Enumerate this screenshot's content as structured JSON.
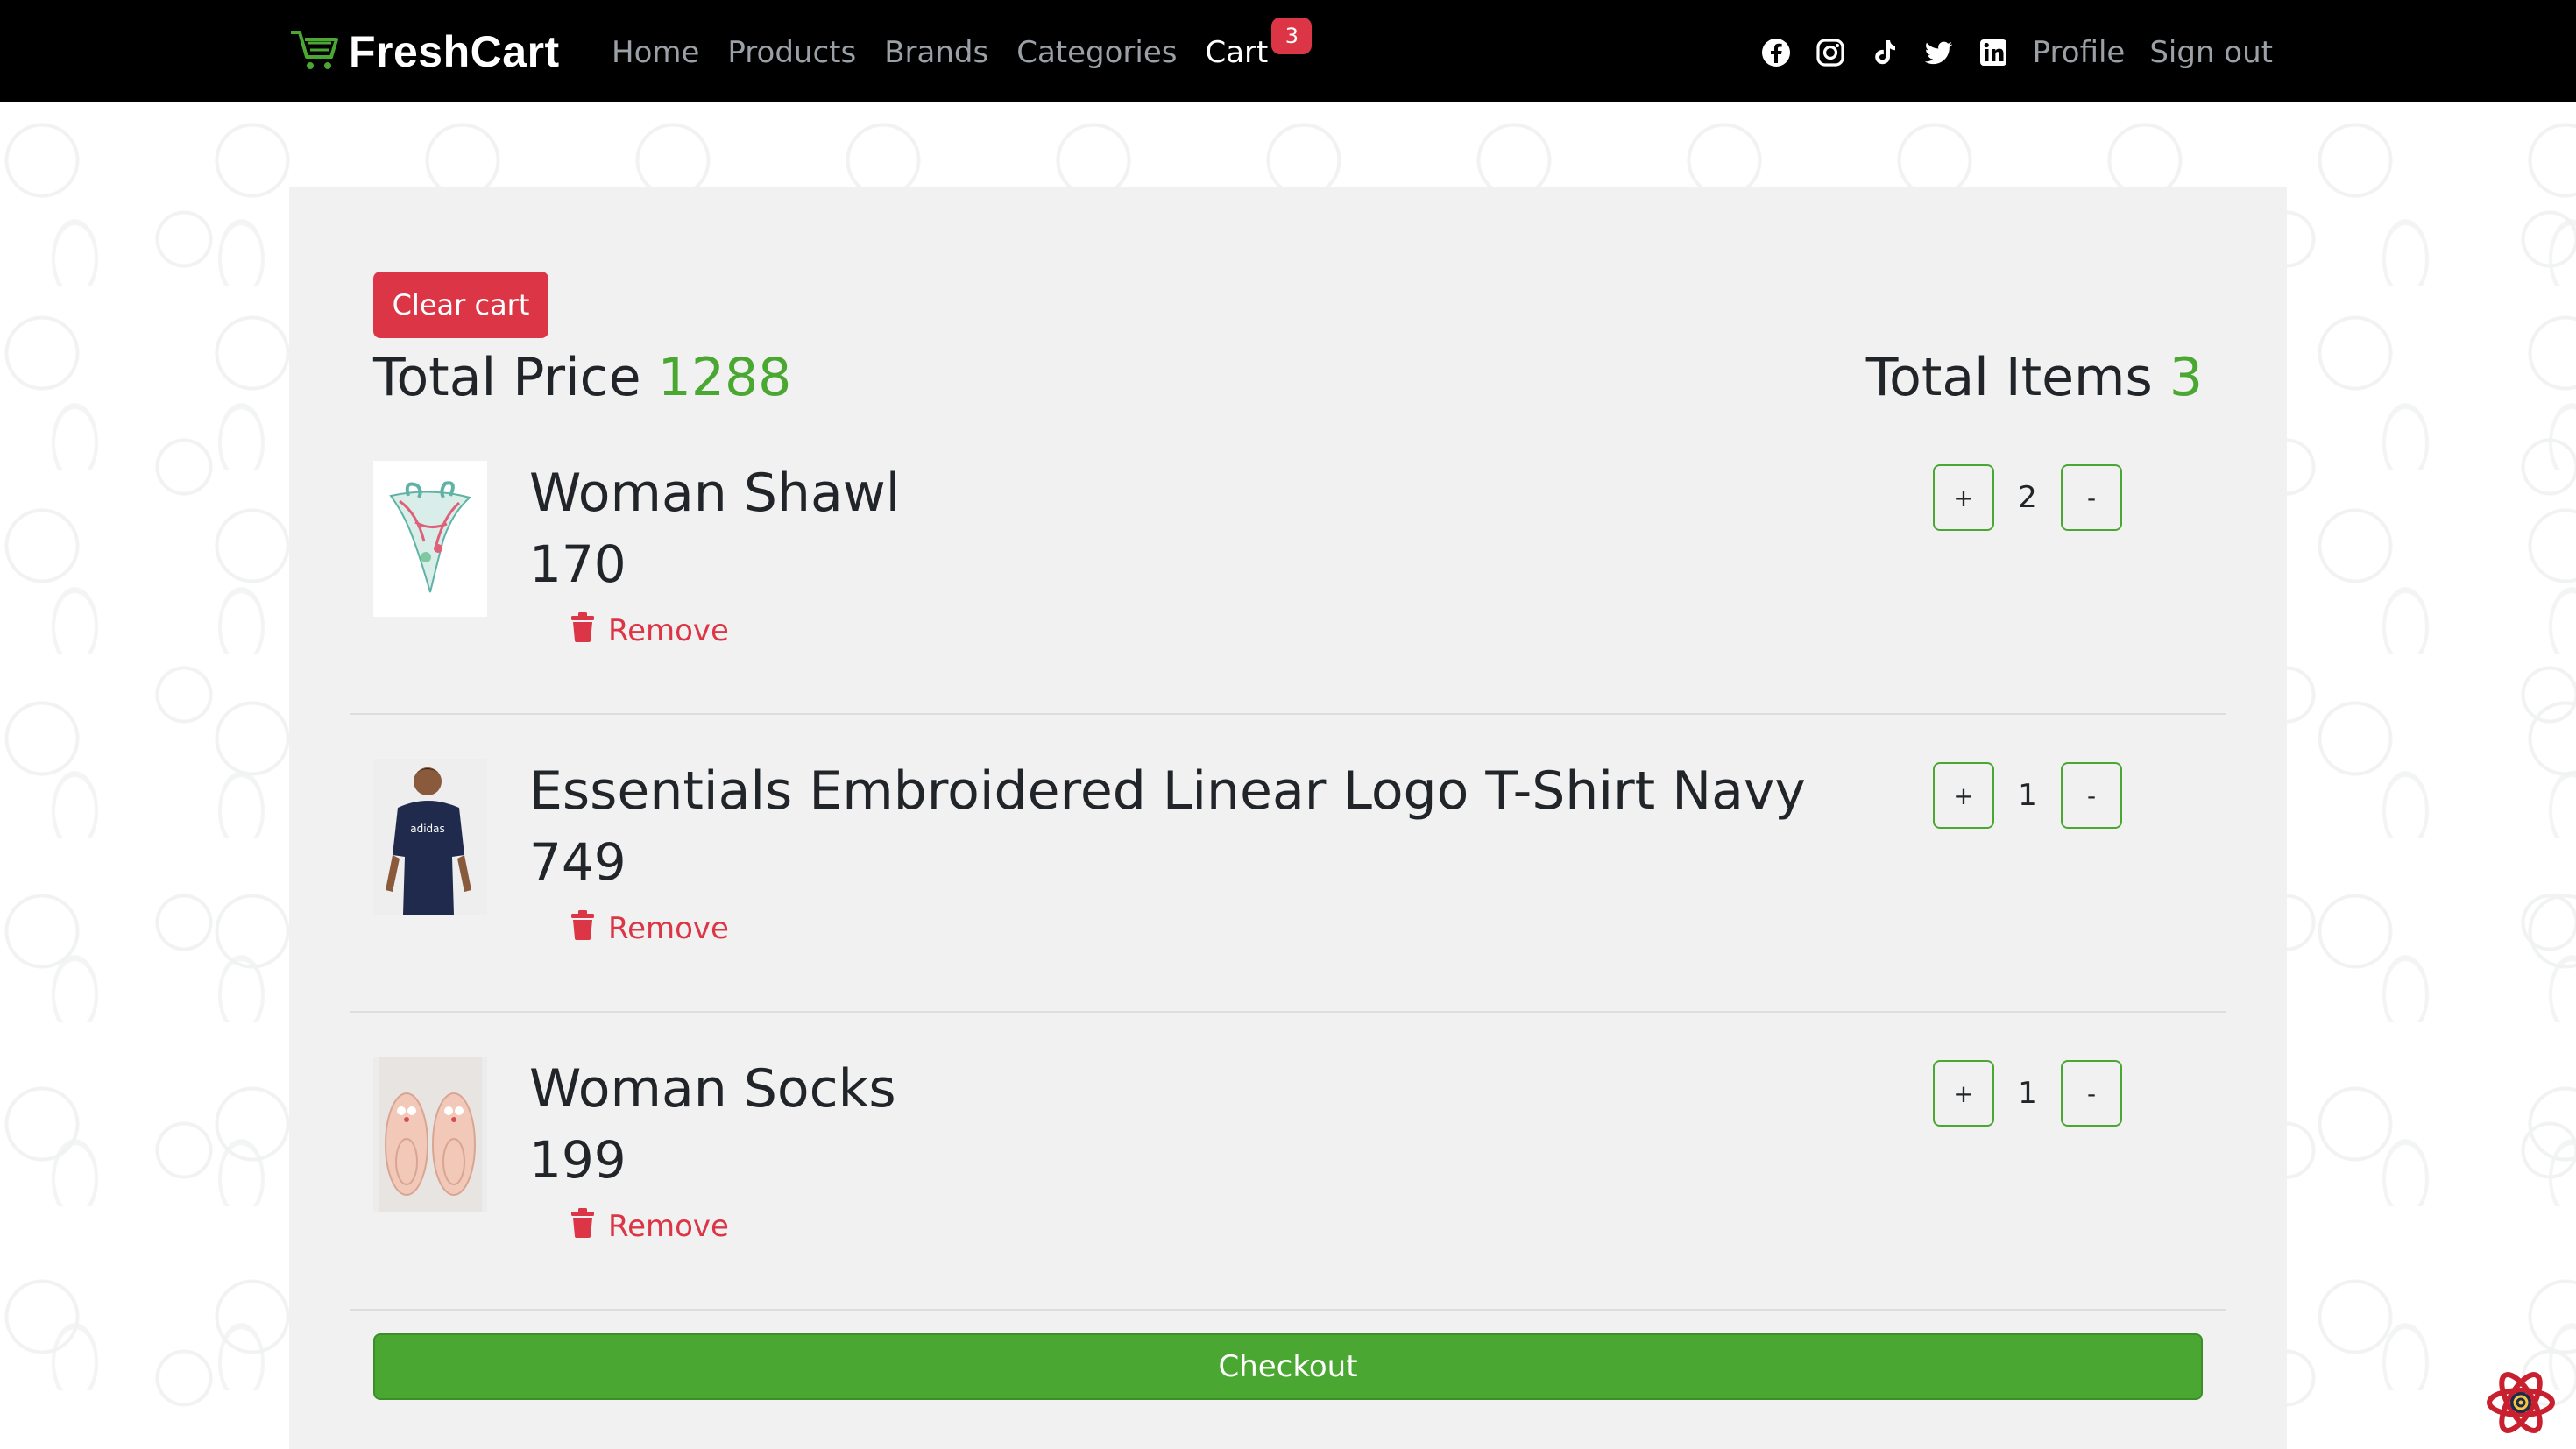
{
  "navbar": {
    "brand": "FreshCart",
    "links": [
      {
        "label": "Home"
      },
      {
        "label": "Products"
      },
      {
        "label": "Brands"
      },
      {
        "label": "Categories"
      },
      {
        "label": "Cart",
        "badge": "3"
      }
    ],
    "social_icons": [
      "facebook-icon",
      "instagram-icon",
      "tiktok-icon",
      "twitter-icon",
      "linkedin-icon"
    ],
    "profile_label": "Profile",
    "signout_label": "Sign out"
  },
  "cart": {
    "clear_label": "Clear cart",
    "total_price_label": "Total Price",
    "total_price_value": "1288",
    "total_items_label": "Total Items",
    "total_items_value": "3",
    "remove_label": "Remove",
    "plus_label": "+",
    "minus_label": "-",
    "items": [
      {
        "title": "Woman Shawl",
        "price": "170",
        "qty": "2"
      },
      {
        "title": "Essentials Embroidered Linear Logo T-Shirt Navy",
        "price": "749",
        "qty": "1"
      },
      {
        "title": "Woman Socks",
        "price": "199",
        "qty": "1"
      }
    ],
    "checkout_label": "Checkout"
  },
  "colors": {
    "accent_green": "#4aa832",
    "danger_red": "#dc3545",
    "navbar_bg": "#000000",
    "panel_bg": "#f0f1f0"
  }
}
